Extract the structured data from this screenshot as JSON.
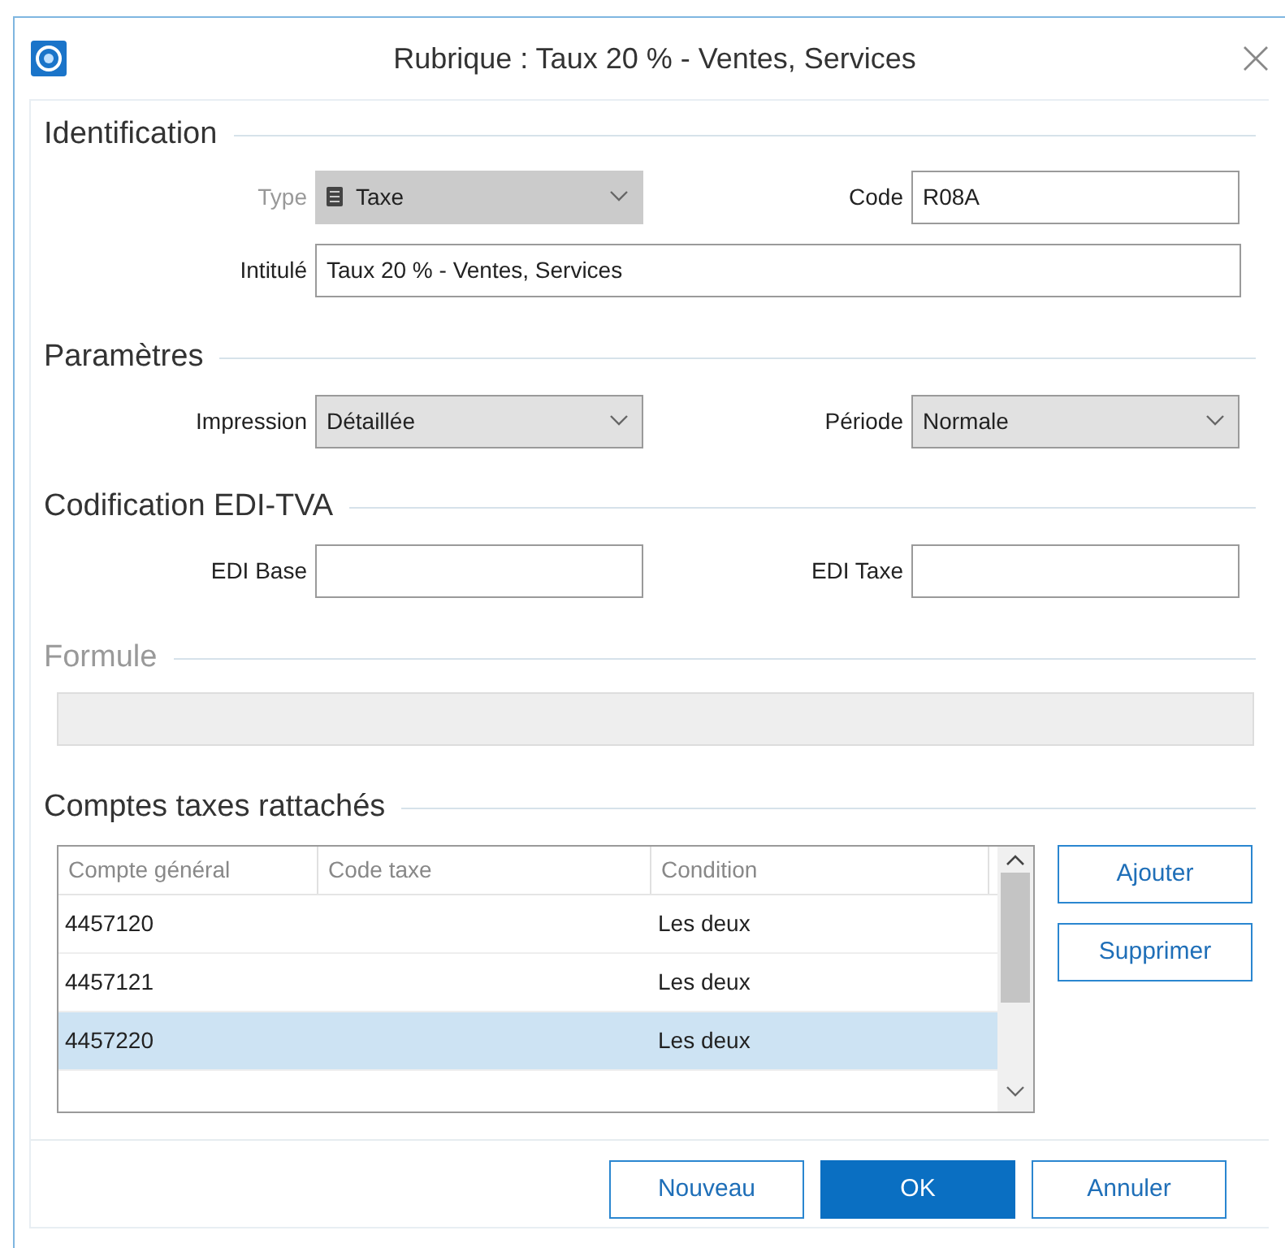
{
  "window": {
    "title": "Rubrique : Taux 20 % - Ventes, Services"
  },
  "identification": {
    "title": "Identification",
    "type": {
      "label": "Type",
      "value": "Taxe",
      "disabled": true
    },
    "code": {
      "label": "Code",
      "value": "R08A"
    },
    "intitule": {
      "label": "Intitulé",
      "value": "Taux 20 % - Ventes, Services"
    }
  },
  "parametres": {
    "title": "Paramètres",
    "impression": {
      "label": "Impression",
      "value": "Détaillée"
    },
    "periode": {
      "label": "Période",
      "value": "Normale"
    }
  },
  "edi": {
    "title": "Codification EDI-TVA",
    "base": {
      "label": "EDI Base"
    },
    "taxe": {
      "label": "EDI Taxe"
    }
  },
  "formule": {
    "title": "Formule",
    "disabled": true
  },
  "comptes": {
    "title": "Comptes taxes rattachés",
    "columns": [
      "Compte général",
      "Code taxe",
      "Condition"
    ],
    "rows": [
      {
        "compte": "4457120",
        "condition": "Les deux",
        "selected": false
      },
      {
        "compte": "4457121",
        "condition": "Les deux",
        "selected": false
      },
      {
        "compte": "4457220",
        "condition": "Les deux",
        "selected": true
      }
    ],
    "buttons": [
      "Ajouter",
      "Supprimer"
    ]
  },
  "footer_buttons": [
    {
      "label": "Nouveau",
      "primary": false
    },
    {
      "label": "OK",
      "primary": true
    },
    {
      "label": "Annuler",
      "primary": false
    }
  ]
}
